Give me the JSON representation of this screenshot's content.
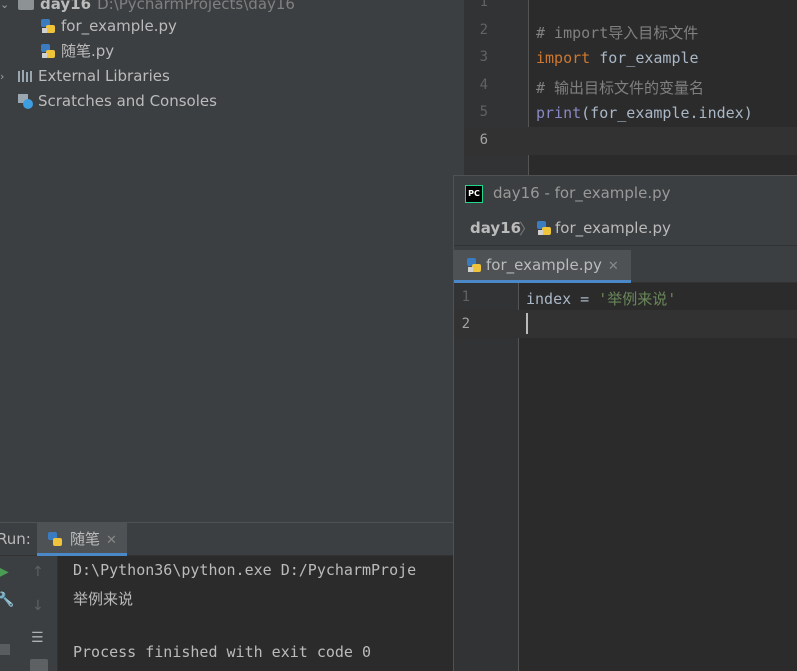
{
  "project_tree": {
    "root": {
      "name": "day16",
      "path": "D:\\PycharmProjects\\day16"
    },
    "files": [
      "for_example.py",
      "随笔.py"
    ],
    "external_libraries": "External Libraries",
    "scratches": "Scratches and Consoles"
  },
  "main_editor": {
    "line_numbers": [
      "1",
      "2",
      "3",
      "4",
      "5",
      "6"
    ],
    "lines": [
      {
        "comment": "# import导入目标文件"
      },
      {
        "keyword": "import",
        "rest": " for_example"
      },
      {
        "comment": "# 输出目标文件的变量名"
      },
      {
        "builtin": "print",
        "rest": "(for_example.index)"
      }
    ]
  },
  "popup": {
    "title": "day16 - for_example.py",
    "breadcrumb_root": "day16",
    "breadcrumb_file": "for_example.py",
    "tab_label": "for_example.py",
    "line_numbers": [
      "1",
      "2"
    ],
    "line1_ident": "index",
    "line1_op": " = ",
    "line1_string": "'举例来说'"
  },
  "run_panel": {
    "label": "Run:",
    "tab_label": "随笔",
    "console": [
      "D:\\Python36\\python.exe D:/PycharmProje",
      "举例来说",
      "",
      "Process finished with exit code 0"
    ]
  },
  "colors": {
    "keyword": "#cc7832",
    "comment": "#808080",
    "string": "#6a8759",
    "builtin": "#8888c6",
    "text": "#a9b7c6",
    "accent": "#4a88c7"
  }
}
